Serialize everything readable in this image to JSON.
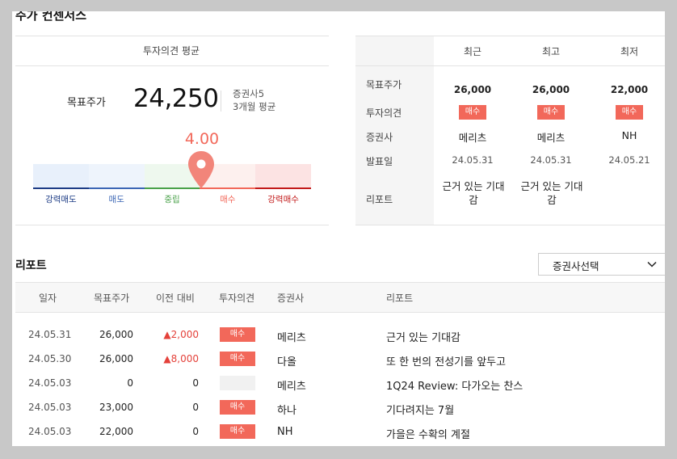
{
  "section_title": "주가 컨센서스",
  "average": {
    "title": "투자의견 평균",
    "target_label": "목표주가",
    "target_value": "24,250",
    "broker_count": "증권사5",
    "period": "3개월 평균",
    "score": "4.00",
    "score_value": 4.0,
    "scale_labels": [
      "강력매도",
      "매도",
      "중립",
      "매수",
      "강력매수"
    ],
    "scale_colors": [
      "#1d3c85",
      "#3c66b5",
      "#4aa24a",
      "#f2685a",
      "#c21a1a"
    ],
    "scale_bg": [
      "#e8f0fb",
      "#eef4fc",
      "#eef8ee",
      "#fdf0ee",
      "#fce3e3"
    ]
  },
  "compare": {
    "headers": [
      "최근",
      "최고",
      "최저"
    ],
    "row_labels": [
      "목표주가",
      "투자의견",
      "증권사",
      "발표일",
      "리포트"
    ],
    "columns": [
      {
        "target": "26,000",
        "opinion": "매수",
        "broker": "메리츠",
        "date": "24.05.31",
        "report": "근거 있는 기대감"
      },
      {
        "target": "26,000",
        "opinion": "매수",
        "broker": "메리츠",
        "date": "24.05.31",
        "report": "근거 있는 기대감"
      },
      {
        "target": "22,000",
        "opinion": "매수",
        "broker": "NH",
        "date": "24.05.21",
        "report": ""
      }
    ]
  },
  "reports": {
    "title": "리포트",
    "select_label": "증권사선택",
    "headers": [
      "일자",
      "목표주가",
      "이전 대비",
      "투자의견",
      "증권사",
      "리포트"
    ],
    "rows": [
      {
        "date": "24.05.31",
        "target": "26,000",
        "change": "▲2,000",
        "opinion": "매수",
        "broker": "메리츠",
        "title": "근거 있는 기대감"
      },
      {
        "date": "24.05.30",
        "target": "26,000",
        "change": "▲8,000",
        "opinion": "매수",
        "broker": "다올",
        "title": "또 한 번의 전성기를 앞두고"
      },
      {
        "date": "24.05.03",
        "target": "0",
        "change": "0",
        "opinion": "",
        "broker": "메리츠",
        "title": "1Q24 Review: 다가오는 찬스"
      },
      {
        "date": "24.05.03",
        "target": "23,000",
        "change": "0",
        "opinion": "매수",
        "broker": "하나",
        "title": "기다려지는 7월"
      },
      {
        "date": "24.05.03",
        "target": "22,000",
        "change": "0",
        "opinion": "매수",
        "broker": "NH",
        "title": "가을은 수확의 계절"
      }
    ]
  }
}
